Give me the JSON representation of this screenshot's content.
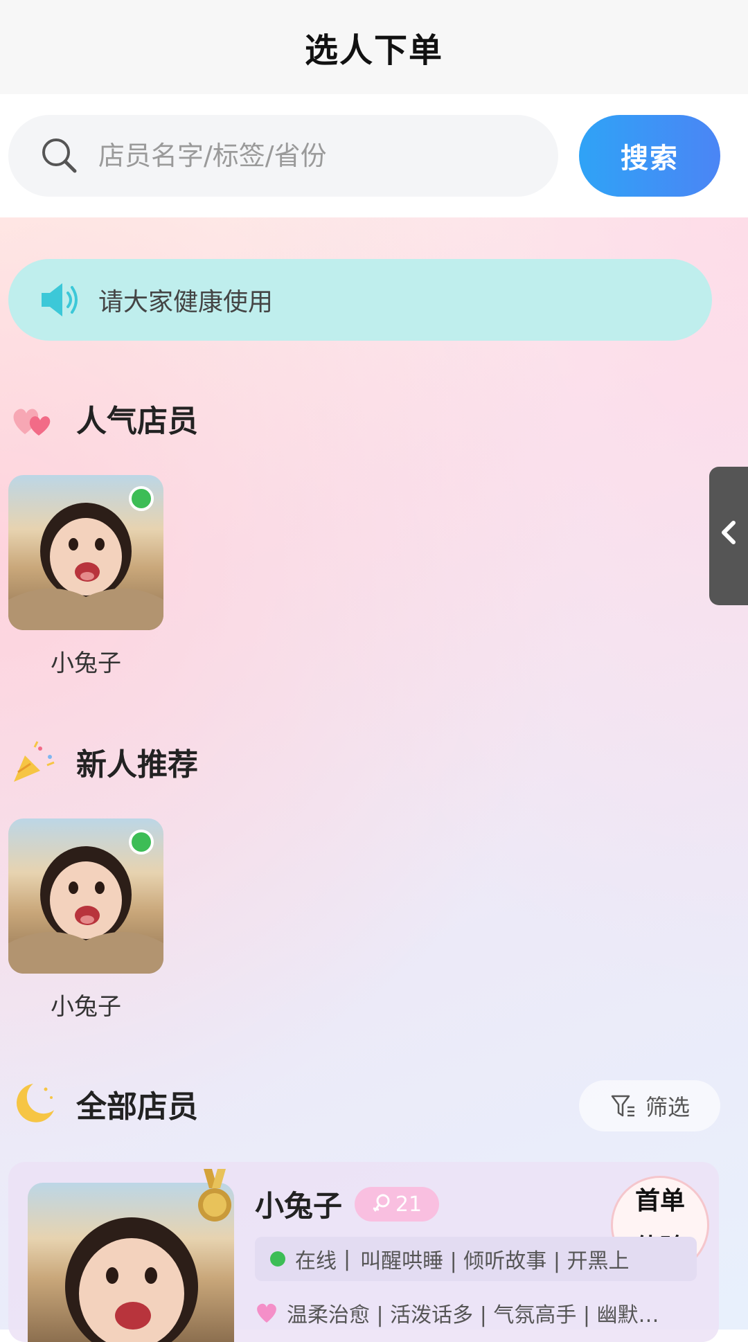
{
  "header": {
    "title": "选人下单"
  },
  "search": {
    "placeholder": "店员名字/标签/省份",
    "button_label": "搜索"
  },
  "notice": {
    "text": "请大家健康使用",
    "icon": "speaker-icon"
  },
  "side_tab": {
    "icon": "chevron-left-icon"
  },
  "sections": {
    "popular": {
      "title": "人气店员",
      "icon": "hearts-icon",
      "items": [
        {
          "name": "小兔子",
          "online": true
        }
      ]
    },
    "newcomers": {
      "title": "新人推荐",
      "icon": "party-popper-icon",
      "items": [
        {
          "name": "小兔子",
          "online": true
        }
      ]
    },
    "all": {
      "title": "全部店员",
      "icon": "moon-icon",
      "filter_label": "筛选"
    }
  },
  "staff_list": [
    {
      "name": "小兔子",
      "age": "21",
      "gender_icon": "female-icon",
      "first_order": [
        "首单",
        "体验"
      ],
      "status": "在线",
      "services": "叫醒哄睡 | 倾听故事 | 开黑上",
      "traits": "温柔治愈 | 活泼话多 | 气氛高手 | 幽默…"
    }
  ],
  "colors": {
    "accent_blue": "#3b95f6",
    "online_green": "#3dbd56",
    "notice_bg": "#bfeeed",
    "badge_pink": "#f9bfe0"
  }
}
